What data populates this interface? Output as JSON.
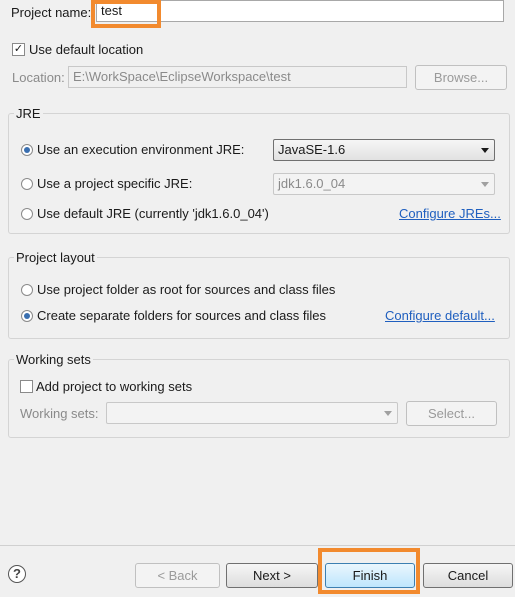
{
  "project": {
    "name_label": "Project name:",
    "name_value": "test",
    "use_default_location_label": "Use default location",
    "use_default_location_checked": true,
    "location_label": "Location:",
    "location_value": "E:\\WorkSpace\\EclipseWorkspace\\test",
    "browse_button": "Browse..."
  },
  "jre": {
    "title": "JRE",
    "options": [
      {
        "label": "Use an execution environment JRE:",
        "selected": true
      },
      {
        "label": "Use a project specific JRE:",
        "selected": false
      },
      {
        "label": "Use default JRE (currently 'jdk1.6.0_04')",
        "selected": false
      }
    ],
    "execution_env_value": "JavaSE-1.6",
    "project_jre_value": "jdk1.6.0_04",
    "configure_link": "Configure JREs..."
  },
  "layout": {
    "title": "Project layout",
    "options": [
      {
        "label": "Use project folder as root for sources and class files",
        "selected": false
      },
      {
        "label": "Create separate folders for sources and class files",
        "selected": true
      }
    ],
    "configure_link": "Configure default..."
  },
  "working_sets": {
    "title": "Working sets",
    "add_label": "Add project to working sets",
    "add_checked": false,
    "sets_label": "Working sets:",
    "sets_value": "",
    "select_button": "Select..."
  },
  "footer": {
    "help_icon": "?",
    "back_button": "< Back",
    "next_button": "Next >",
    "finish_button": "Finish",
    "cancel_button": "Cancel"
  },
  "colors": {
    "highlight": "#f28a2e",
    "link": "#1f5fbf",
    "background": "#f0f0f0"
  }
}
